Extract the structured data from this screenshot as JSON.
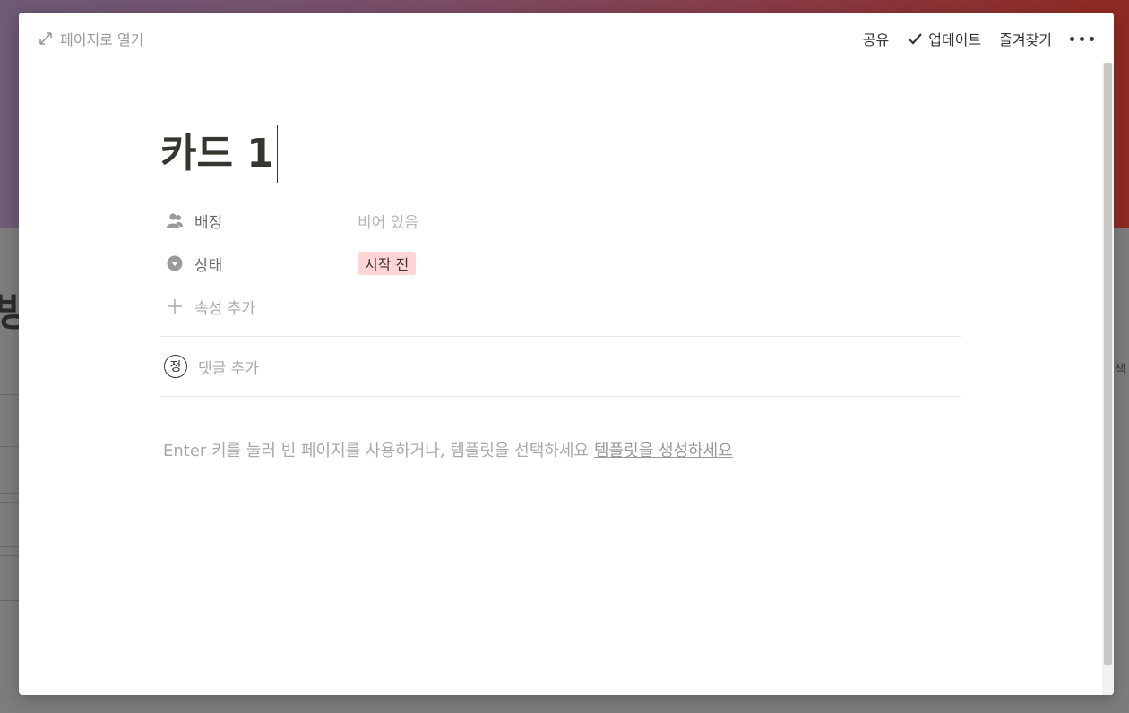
{
  "background": {
    "title_fragment": "빙",
    "right_fragment": "색"
  },
  "topbar": {
    "open_page": "페이지로 열기",
    "share": "공유",
    "updates": "업데이트",
    "favorite": "즐겨찾기"
  },
  "page": {
    "title": "카드 1",
    "properties": [
      {
        "name": "배정",
        "value": "비어 있음",
        "icon": "person-icon"
      },
      {
        "name": "상태",
        "value": "시작 전",
        "icon": "status-dropdown-icon"
      }
    ],
    "add_property": "속성 추가",
    "comment": {
      "avatar_letter": "정",
      "placeholder": "댓글 추가"
    },
    "empty_hint": "Enter 키를 눌러 빈 페이지를 사용하거나, 템플릿을 선택하세요",
    "create_template": "템플릿을 생성하세요"
  },
  "colors": {
    "status_tag_bg": "#ffd5d5",
    "text_primary": "#37352f",
    "text_muted": "#a9a8a5"
  }
}
